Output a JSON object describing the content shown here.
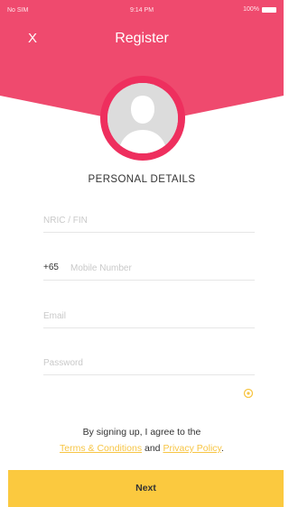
{
  "status_bar": {
    "carrier": "No SIM",
    "time": "9:14 PM",
    "battery": "100%"
  },
  "header": {
    "title": "Register",
    "close_label": "X"
  },
  "section_title": "PERSONAL DETAILS",
  "fields": {
    "nric_placeholder": "NRIC / FIN",
    "mobile_prefix": "+65",
    "mobile_placeholder": "Mobile Number",
    "email_placeholder": "Email",
    "password_placeholder": "Password"
  },
  "agreement": {
    "text": "By signing up, I agree to the",
    "terms_link": "Terms & Conditions",
    "and": "and",
    "privacy_link": "Privacy Policy",
    "period": "."
  },
  "next_button": "Next",
  "colors": {
    "header": "#ef4a6e",
    "accent": "#ee2f5e",
    "button": "#fbc93f",
    "link": "#f7c544"
  },
  "icons": {
    "close": "close-icon",
    "avatar": "user-avatar-icon",
    "eye": "eye-icon",
    "battery": "battery-icon"
  }
}
